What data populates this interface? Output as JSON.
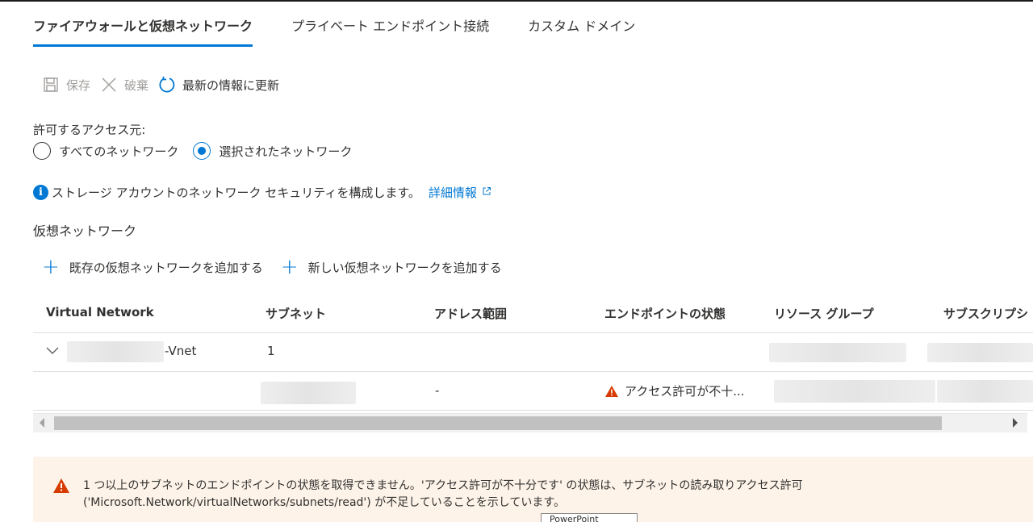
{
  "tabs": [
    {
      "label": "ファイアウォールと仮想ネットワーク",
      "active": true
    },
    {
      "label": "プライベート エンドポイント接続",
      "active": false
    },
    {
      "label": "カスタム ドメイン",
      "active": false
    }
  ],
  "toolbar": {
    "save_label": "保存",
    "discard_label": "破棄",
    "refresh_label": "最新の情報に更新"
  },
  "access": {
    "label": "許可するアクセス元:",
    "option_all": "すべてのネットワーク",
    "option_selected": "選択されたネットワーク",
    "selected": "option_selected"
  },
  "info": {
    "text": "ストレージ アカウントのネットワーク セキュリティを構成します。",
    "link": "詳細情報"
  },
  "vnet_section": {
    "title": "仮想ネットワーク",
    "add_existing": "既存の仮想ネットワークを追加する",
    "add_new": "新しい仮想ネットワークを追加する"
  },
  "table": {
    "headers": [
      "Virtual Network",
      "サブネット",
      "アドレス範囲",
      "エンドポイントの状態",
      "リソース グループ",
      "サブスクリプシ"
    ],
    "rows": [
      {
        "vnet_suffix": "-Vnet",
        "subnet_count": "1"
      },
      {
        "address_range": "-",
        "endpoint_status": "アクセス許可が不十..."
      }
    ]
  },
  "warning": {
    "line1": "1 つ以上のサブネットのエンドポイントの状態を取得できません。'アクセス許可が不十分です' の状態は、サブネットの読み取りアクセス許可",
    "line2": "('Microsoft.Network/virtualNetworks/subnets/read') が不足していることを示しています。"
  },
  "tooltip": "PowerPoint",
  "colors": {
    "accent": "#0078d4",
    "warning": "#d83b01",
    "warning_bg": "#fdf3e8"
  }
}
